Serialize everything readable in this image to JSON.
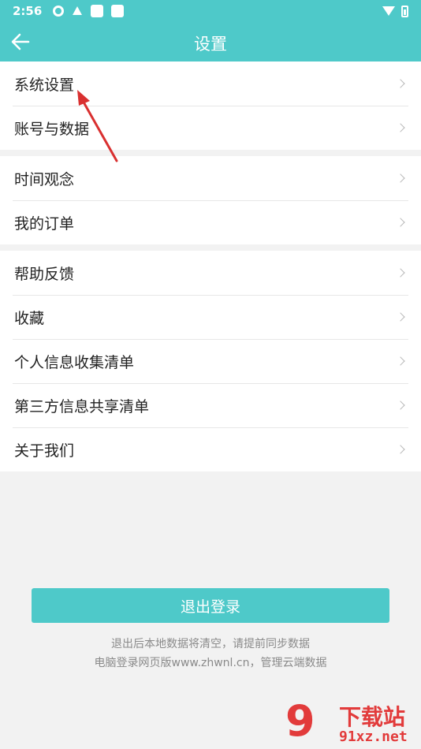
{
  "status_bar": {
    "time": "2:56"
  },
  "header": {
    "title": "设置"
  },
  "groups": [
    {
      "items": [
        {
          "label": "系统设置"
        },
        {
          "label": "账号与数据"
        }
      ]
    },
    {
      "items": [
        {
          "label": "时间观念"
        },
        {
          "label": "我的订单"
        }
      ]
    },
    {
      "items": [
        {
          "label": "帮助反馈"
        },
        {
          "label": "收藏"
        },
        {
          "label": "个人信息收集清单"
        },
        {
          "label": "第三方信息共享清单"
        },
        {
          "label": "关于我们"
        }
      ]
    }
  ],
  "logout": {
    "label": "退出登录",
    "note1": "退出后本地数据将清空，请提前同步数据",
    "note2": "电脑登录网页版www.zhwnl.cn，管理云端数据"
  },
  "watermark": {
    "logo_digit": "9",
    "brand": "下载站",
    "url": "91xz.net"
  },
  "colors": {
    "accent": "#4ec9c9",
    "annotation": "#d93030",
    "background": "#f2f2f2"
  },
  "icons": [
    "back-arrow-icon",
    "chevron-right-icon",
    "wifi-icon",
    "battery-icon"
  ]
}
